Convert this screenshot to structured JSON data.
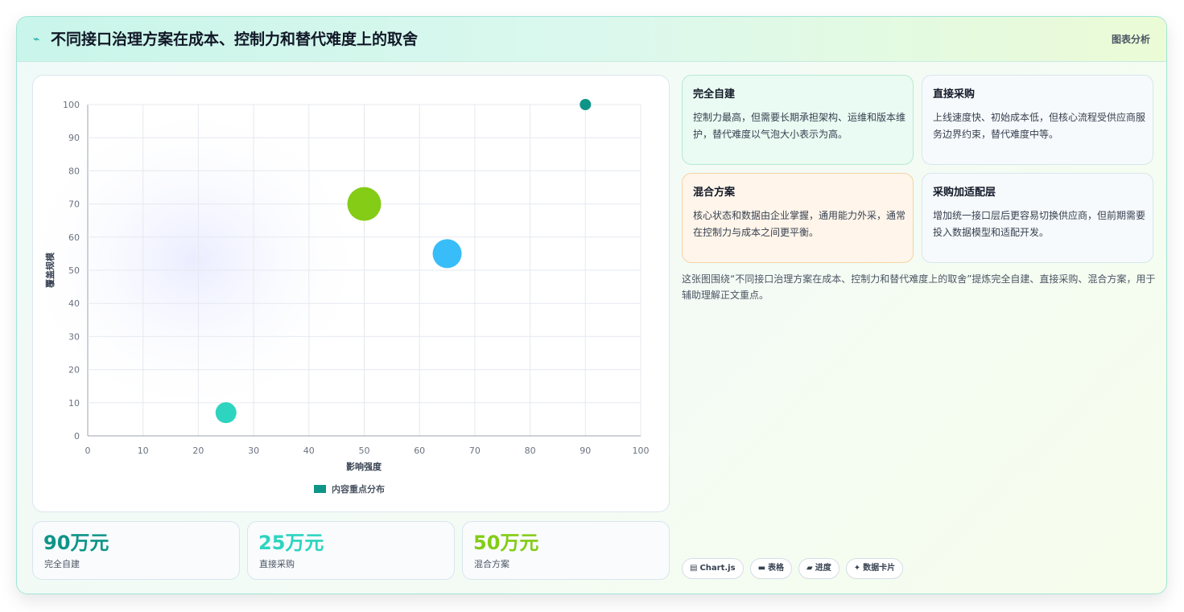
{
  "header": {
    "icon": "lightning-icon",
    "title": "不同接口治理方案在成本、控制力和替代难度上的取舍",
    "tag": "图表分析"
  },
  "chart_data": {
    "type": "bubble",
    "xlabel": "影响强度",
    "ylabel": "覆盖规模",
    "xlim": [
      0,
      100
    ],
    "ylim": [
      0,
      100
    ],
    "xticks": [
      "0",
      "10",
      "20",
      "30",
      "40",
      "50",
      "60",
      "70",
      "80",
      "90",
      "100"
    ],
    "yticks": [
      "0",
      "10",
      "20",
      "30",
      "40",
      "50",
      "60",
      "70",
      "80",
      "90",
      "100"
    ],
    "grid": true,
    "legend": {
      "position": "bottom",
      "label": "内容重点分布",
      "color": "#0f9488"
    },
    "points": [
      {
        "x": 90,
        "y": 100,
        "r": 7,
        "color": "#0f9488"
      },
      {
        "x": 50,
        "y": 70,
        "r": 21,
        "color": "#84cc16"
      },
      {
        "x": 65,
        "y": 55,
        "r": 18,
        "color": "#38bdf8"
      },
      {
        "x": 25,
        "y": 7,
        "r": 13,
        "color": "#2dd4bf"
      }
    ]
  },
  "stats": [
    {
      "value": "90万元",
      "label": "完全自建",
      "color": "#0f9488"
    },
    {
      "value": "25万元",
      "label": "直接采购",
      "color": "#2dd4bf"
    },
    {
      "value": "50万元",
      "label": "混合方案",
      "color": "#84cc16"
    }
  ],
  "cards": [
    {
      "title": "完全自建",
      "text": "控制力最高，但需要长期承担架构、运维和版本维护，替代难度以气泡大小表示为高。"
    },
    {
      "title": "直接采购",
      "text": "上线速度快、初始成本低，但核心流程受供应商服务边界约束，替代难度中等。"
    },
    {
      "title": "混合方案",
      "text": "核心状态和数据由企业掌握，通用能力外采，通常在控制力与成本之间更平衡。"
    },
    {
      "title": "采购加适配层",
      "text": "增加统一接口层后更容易切换供应商，但前期需要投入数据模型和适配开发。"
    }
  ],
  "description": "这张图围绕“不同接口治理方案在成本、控制力和替代难度上的取舍”提炼完全自建、直接采购、混合方案，用于辅助理解正文重点。",
  "tags": [
    {
      "icon": "▤",
      "label": "Chart.js"
    },
    {
      "icon": "▬",
      "label": "表格"
    },
    {
      "icon": "▰",
      "label": "进度"
    },
    {
      "icon": "✦",
      "label": "数据卡片"
    }
  ]
}
